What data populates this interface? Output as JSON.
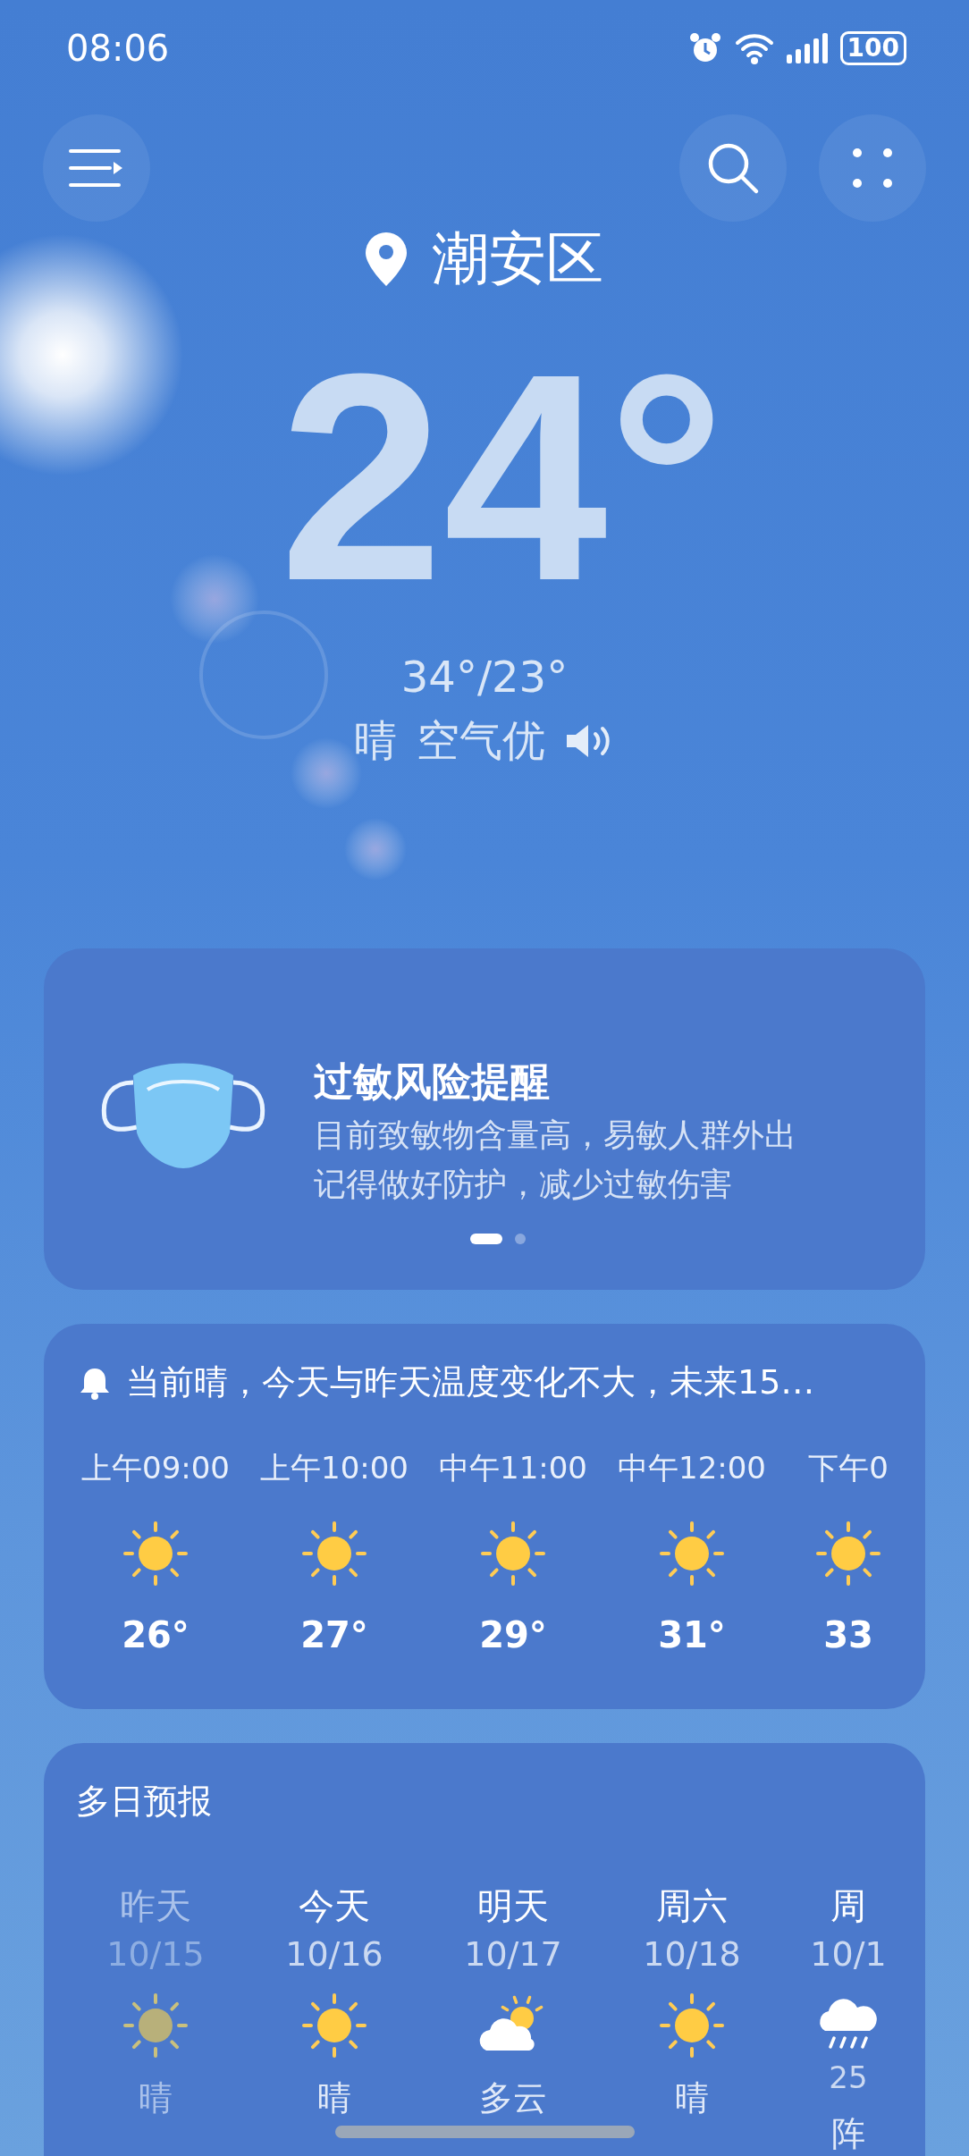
{
  "status_bar": {
    "time": "08:06",
    "battery": "100"
  },
  "location": {
    "city": "潮安区"
  },
  "current": {
    "temperature": "24°",
    "range": "34°/23°",
    "condition": "晴",
    "air_quality": "空气优"
  },
  "alert_card": {
    "title": "过敏风险提醒",
    "lines": [
      "目前致敏物含量高，易敏人群外出",
      "记得做好防护，减少过敏伤害"
    ],
    "pages": [
      {
        "selected": true
      },
      {
        "selected": false
      }
    ]
  },
  "hourly": {
    "summary": "当前晴，今天与昨天温度变化不大，未来15…",
    "items": [
      {
        "time": "上午09:00",
        "kind": "sunny",
        "temp": "26°"
      },
      {
        "time": "上午10:00",
        "kind": "sunny",
        "temp": "27°"
      },
      {
        "time": "中午11:00",
        "kind": "sunny",
        "temp": "29°"
      },
      {
        "time": "中午12:00",
        "kind": "sunny",
        "temp": "31°"
      },
      {
        "time": "下午0",
        "kind": "sunny",
        "temp": "33"
      }
    ]
  },
  "daily": {
    "title": "多日预报",
    "items": [
      {
        "day": "昨天",
        "date": "10/15",
        "kind": "sunny",
        "condition": "晴",
        "past": true
      },
      {
        "day": "今天",
        "date": "10/16",
        "kind": "sunny",
        "condition": "晴",
        "past": false
      },
      {
        "day": "明天",
        "date": "10/17",
        "kind": "partly_cloudy",
        "condition": "多云",
        "past": false
      },
      {
        "day": "周六",
        "date": "10/18",
        "kind": "sunny",
        "condition": "晴",
        "past": false
      },
      {
        "day": "周",
        "date": "10/1",
        "kind": "rain",
        "precip": "25",
        "condition": "阵",
        "past": false
      }
    ]
  }
}
